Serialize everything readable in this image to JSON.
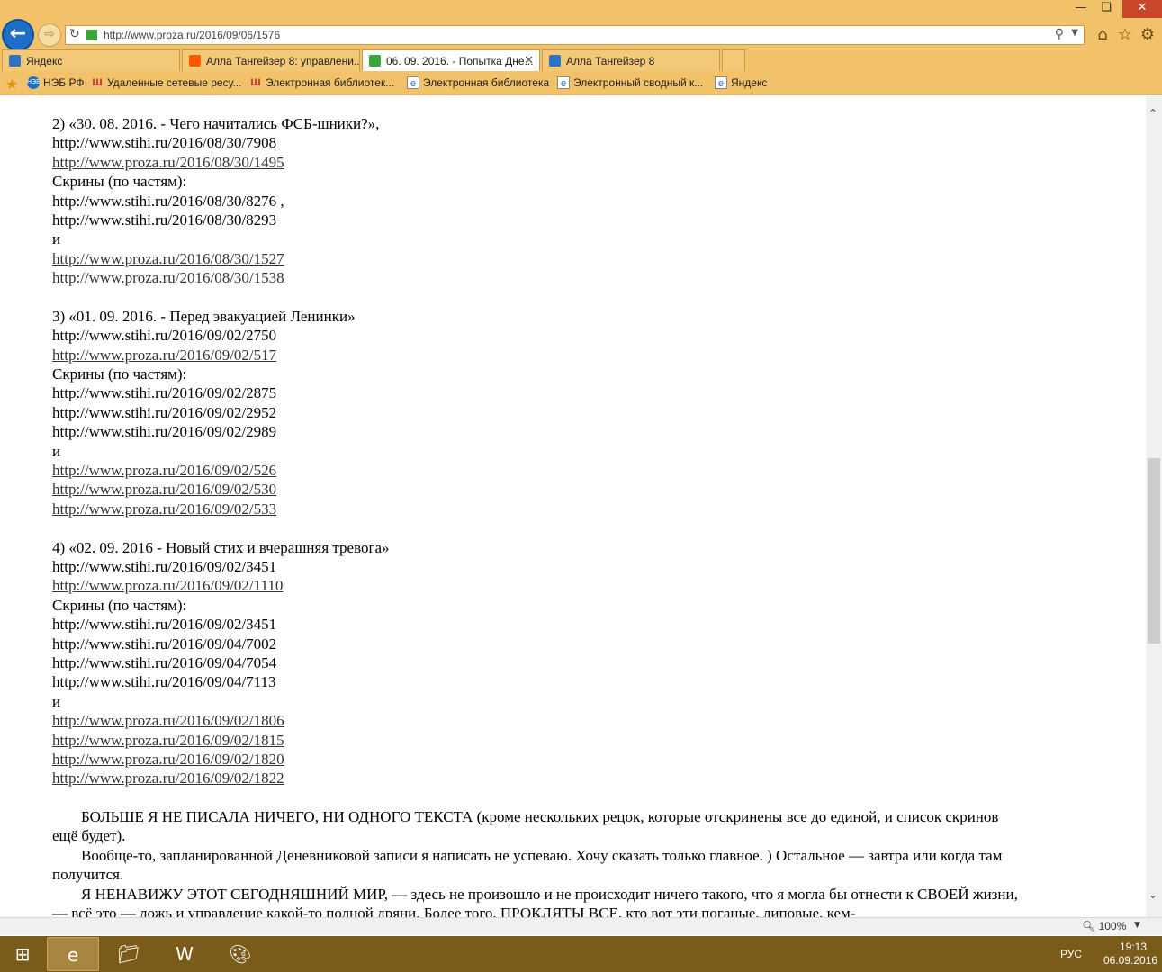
{
  "browser": {
    "url": "http://www.proza.ru/2016/09/06/1576",
    "tabs": [
      {
        "label": "Яндекс",
        "color": "#2f73c4"
      },
      {
        "label": "Алла Тангейзер 8: управлени...",
        "color": "#ff5a00"
      },
      {
        "label": "06. 09. 2016. - Попытка Дне...",
        "color": "#3aa63a",
        "active": true
      },
      {
        "label": "Алла Тангейзер 8",
        "color": "#2f73c4"
      }
    ],
    "favorites": [
      {
        "label": "НЭБ РФ",
        "icon": "neb-icon"
      },
      {
        "label": "Удаленные сетевые ресу...",
        "icon": "library-icon"
      },
      {
        "label": "Электронная библиотек...",
        "icon": "library-icon"
      },
      {
        "label": "Электронная библиотека",
        "icon": "ie-page-icon"
      },
      {
        "label": "Электронный сводный к...",
        "icon": "ie-page-icon"
      },
      {
        "label": "Яндекс",
        "icon": "ie-page-icon"
      }
    ]
  },
  "content": {
    "lines": [
      {
        "text": "2) «30. 08. 2016. - Чего начитались ФСБ-шники?»,",
        "link": false
      },
      {
        "text": "http://www.stihi.ru/2016/08/30/7908",
        "link": false
      },
      {
        "text": "http://www.proza.ru/2016/08/30/1495",
        "link": true
      },
      {
        "text": "Скрины (по частям):",
        "link": false
      },
      {
        "text": "http://www.stihi.ru/2016/08/30/8276 ,",
        "link": false
      },
      {
        "text": "http://www.stihi.ru/2016/08/30/8293",
        "link": false
      },
      {
        "text": "и",
        "link": false
      },
      {
        "text": "http://www.proza.ru/2016/08/30/1527",
        "link": true
      },
      {
        "text": "http://www.proza.ru/2016/08/30/1538",
        "link": true
      },
      {
        "text": "",
        "link": false
      },
      {
        "text": "3) «01. 09. 2016. - Перед эвакуацией Ленинки»",
        "link": false
      },
      {
        "text": "http://www.stihi.ru/2016/09/02/2750",
        "link": false
      },
      {
        "text": "http://www.proza.ru/2016/09/02/517",
        "link": true
      },
      {
        "text": "Скрины (по частям):",
        "link": false
      },
      {
        "text": "http://www.stihi.ru/2016/09/02/2875",
        "link": false
      },
      {
        "text": "http://www.stihi.ru/2016/09/02/2952",
        "link": false
      },
      {
        "text": "http://www.stihi.ru/2016/09/02/2989",
        "link": false
      },
      {
        "text": "и",
        "link": false
      },
      {
        "text": "http://www.proza.ru/2016/09/02/526",
        "link": true
      },
      {
        "text": "http://www.proza.ru/2016/09/02/530",
        "link": true
      },
      {
        "text": "http://www.proza.ru/2016/09/02/533",
        "link": true
      },
      {
        "text": "",
        "link": false
      },
      {
        "text": "4) «02. 09. 2016 - Новый стих и вчерашняя тревога»",
        "link": false
      },
      {
        "text": "http://www.stihi.ru/2016/09/02/3451",
        "link": false
      },
      {
        "text": "http://www.proza.ru/2016/09/02/1110",
        "link": true
      },
      {
        "text": "Скрины (по частям):",
        "link": false
      },
      {
        "text": "http://www.stihi.ru/2016/09/02/3451",
        "link": false
      },
      {
        "text": "http://www.stihi.ru/2016/09/04/7002",
        "link": false
      },
      {
        "text": "http://www.stihi.ru/2016/09/04/7054",
        "link": false
      },
      {
        "text": "http://www.stihi.ru/2016/09/04/7113",
        "link": false
      },
      {
        "text": "и",
        "link": false
      },
      {
        "text": "http://www.proza.ru/2016/09/02/1806",
        "link": true
      },
      {
        "text": "http://www.proza.ru/2016/09/02/1815",
        "link": true
      },
      {
        "text": "http://www.proza.ru/2016/09/02/1820",
        "link": true
      },
      {
        "text": "http://www.proza.ru/2016/09/02/1822",
        "link": true
      },
      {
        "text": "",
        "link": false
      }
    ],
    "paragraphs": [
      "БОЛЬШЕ Я НЕ ПИСАЛА НИЧЕГО, НИ ОДНОГО ТЕКСТА (кроме нескольких рецок, которые отскринены все до единой, и список скринов ещё будет).",
      "Вообще-то, запланированной Деневниковой записи я написать не успеваю. Хочу сказать только главное. ) Остальное — завтра или когда там получится.",
      "Я НЕНАВИЖУ ЭТОТ СЕГОДНЯШНИЙ МИР, — здесь не произошло и не происходит ничего такого, что я могла бы отнести к СВОЕЙ жизни, — всё это — ложь и управление какой-то полной дряни. Более того, ПРОКЛЯТЫ ВСЕ, кто вот эти поганые, липовые, кем-"
    ]
  },
  "statusbar": {
    "zoom": "100%"
  },
  "taskbar": {
    "apps": [
      {
        "name": "start-icon"
      },
      {
        "name": "internet-explorer-icon",
        "active": true
      },
      {
        "name": "file-explorer-icon"
      },
      {
        "name": "word-icon"
      },
      {
        "name": "paint-icon"
      }
    ],
    "language": "РУС",
    "time": "19:13",
    "date": "06.09.2016"
  }
}
